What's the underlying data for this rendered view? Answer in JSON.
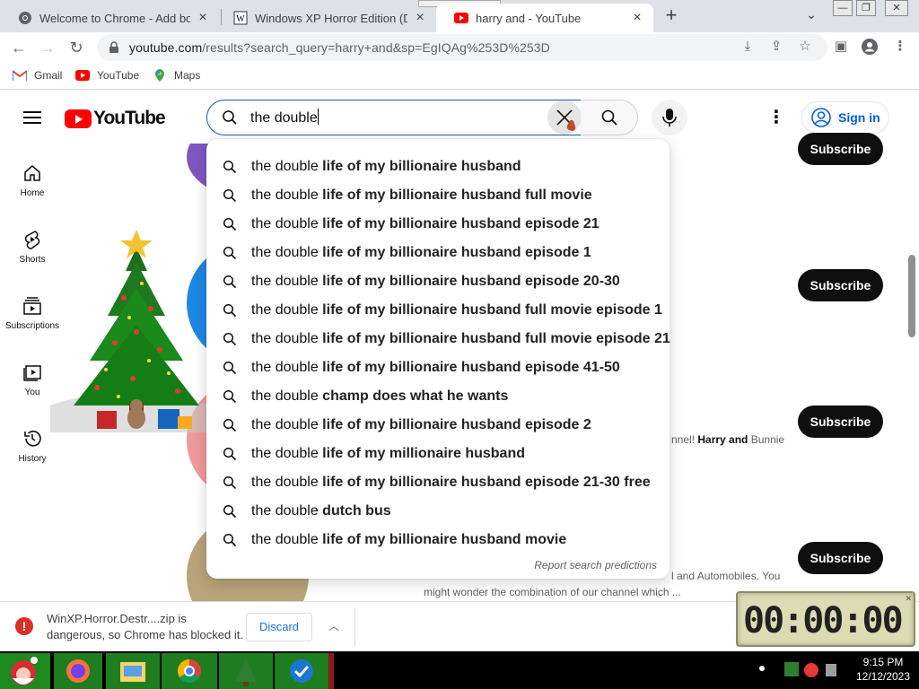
{
  "browser": {
    "tabs": [
      {
        "title": "Welcome to Chrome - Add book",
        "icon": "chrome-icon"
      },
      {
        "title": "Windows XP Horror Edition (Dest",
        "icon": "wikipedia-icon"
      },
      {
        "title": "harry and - YouTube",
        "icon": "youtube-icon",
        "active": true
      }
    ],
    "url": "youtube.com/results?search_query=harry+and&sp=EgIQAg%253D%253D",
    "url_host": "youtube.com",
    "url_path": "/results?search_query=harry+and&sp=EgIQAg%253D%253D",
    "bookmarks": [
      {
        "label": "Gmail",
        "icon": "gmail-icon"
      },
      {
        "label": "YouTube",
        "icon": "youtube-icon"
      },
      {
        "label": "Maps",
        "icon": "maps-icon"
      }
    ]
  },
  "youtube": {
    "logo_text": "YouTube",
    "search_query": "the double",
    "sign_in_label": "Sign in",
    "sidebar": [
      {
        "label": "Home",
        "icon": "home-icon"
      },
      {
        "label": "Shorts",
        "icon": "shorts-icon"
      },
      {
        "label": "Subscriptions",
        "icon": "subscriptions-icon"
      },
      {
        "label": "You",
        "icon": "library-icon"
      },
      {
        "label": "History",
        "icon": "history-icon"
      }
    ],
    "suggestions": [
      {
        "prefix": "the double",
        "rest": " life of my billionaire husband"
      },
      {
        "prefix": "the double",
        "rest": " life of my billionaire husband full movie"
      },
      {
        "prefix": "the double",
        "rest": " life of my billionaire husband episode 21"
      },
      {
        "prefix": "the double",
        "rest": " life of my billionaire husband episode 1"
      },
      {
        "prefix": "the double",
        "rest": " life of my billionaire husband episode 20-30"
      },
      {
        "prefix": "the double",
        "rest": " life of my billionaire husband full movie episode 1"
      },
      {
        "prefix": "the double",
        "rest": " life of my billionaire husband full movie episode 21"
      },
      {
        "prefix": "the double",
        "rest": " life of my billionaire husband episode 41-50"
      },
      {
        "prefix": "the double",
        "rest": " champ does what he wants"
      },
      {
        "prefix": "the double",
        "rest": " life of my billionaire husband episode 2"
      },
      {
        "prefix": "the double",
        "rest": " life of my millionaire husband"
      },
      {
        "prefix": "the double",
        "rest": " life of my billionaire husband episode 21-30 free"
      },
      {
        "prefix": "the double",
        "rest": " dutch bus"
      },
      {
        "prefix": "the double",
        "rest": " life of my billionaire husband movie"
      }
    ],
    "report_label": "Report search predictions",
    "subscribe_label": "Subscribe",
    "result_snippets": {
      "snippet1_pre": "nnel! ",
      "snippet1_bold": "Harry and",
      "snippet1_post": " Bunnie",
      "snippet2_line1": "l and Automobiles. You",
      "snippet2_line2": "might wonder the combination of our channel which ..."
    }
  },
  "download_bar": {
    "filename_line": "WinXP.Horror.Destr....zip is",
    "warning_line": "dangerous, so Chrome has blocked it.",
    "discard_label": "Discard"
  },
  "timer": {
    "display": "00:00:00"
  },
  "taskbar": {
    "time": "9:15 PM",
    "date": "12/12/2023"
  },
  "colors": {
    "youtube_red": "#ff0000",
    "subscribe_bg": "#0f0f0f",
    "link_blue": "#065fd4",
    "warning_red": "#d93025"
  }
}
